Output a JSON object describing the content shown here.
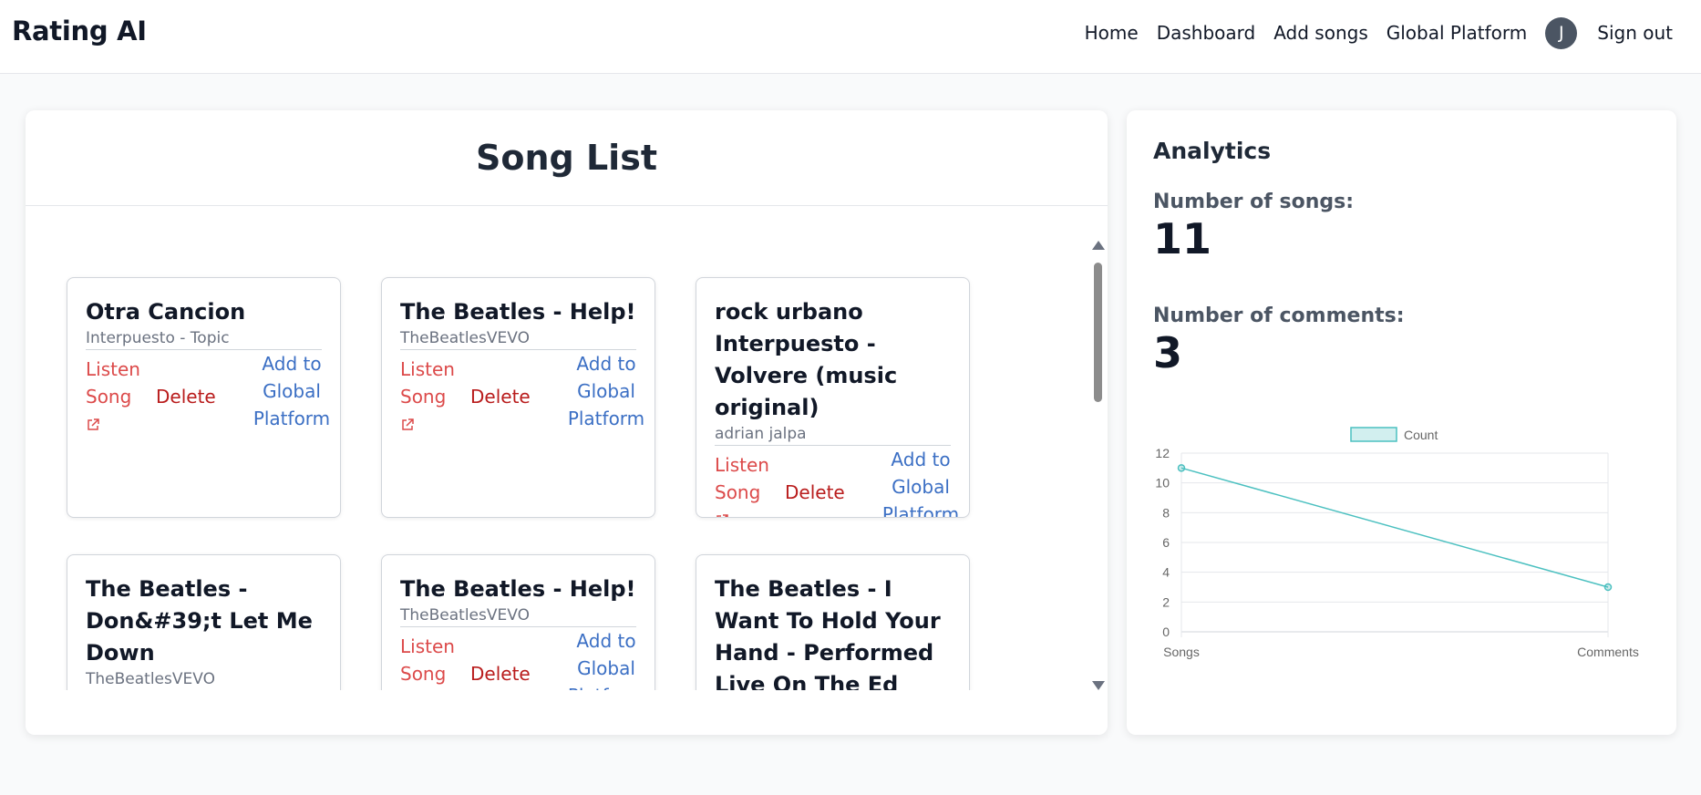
{
  "app": {
    "brand": "Rating AI"
  },
  "nav": {
    "home": "Home",
    "dashboard": "Dashboard",
    "add_songs": "Add songs",
    "global_platform": "Global Platform",
    "avatar_initial": "J",
    "sign_out": "Sign out"
  },
  "song_list": {
    "title": "Song List",
    "listen_label": "Listen Song",
    "delete_label": "Delete",
    "global_label": "Add to Global Platform",
    "songs": [
      {
        "title": "Otra Cancion",
        "channel": "Interpuesto - Topic"
      },
      {
        "title": "The Beatles - Help!",
        "channel": "TheBeatlesVEVO"
      },
      {
        "title": "rock urbano Interpuesto - Volvere (music original)",
        "channel": "adrian jalpa"
      },
      {
        "title": "The Beatles - Don&#39;t Let Me Down",
        "channel": "TheBeatlesVEVO"
      },
      {
        "title": "The Beatles - Help!",
        "channel": "TheBeatlesVEVO"
      },
      {
        "title": "The Beatles - I Want To Hold Your Hand - Performed Live On The Ed Sullivan",
        "channel": ""
      }
    ]
  },
  "analytics": {
    "title": "Analytics",
    "songs_label": "Number of songs:",
    "songs_count": "11",
    "comments_label": "Number of comments:",
    "comments_count": "3"
  },
  "colors": {
    "line": "#4bc0c0",
    "listen": "#dc4a4a",
    "delete": "#b91c1c",
    "global": "#3b6fc4"
  },
  "icons": {
    "listen": "external-link-icon"
  },
  "chart_data": {
    "type": "line",
    "categories": [
      "Songs",
      "Comments"
    ],
    "series": [
      {
        "name": "Count",
        "values": [
          11,
          3
        ]
      }
    ],
    "ylim": [
      0,
      12
    ],
    "yticks": [
      0,
      2,
      4,
      6,
      8,
      10,
      12
    ],
    "grid": true,
    "legend": "top"
  }
}
